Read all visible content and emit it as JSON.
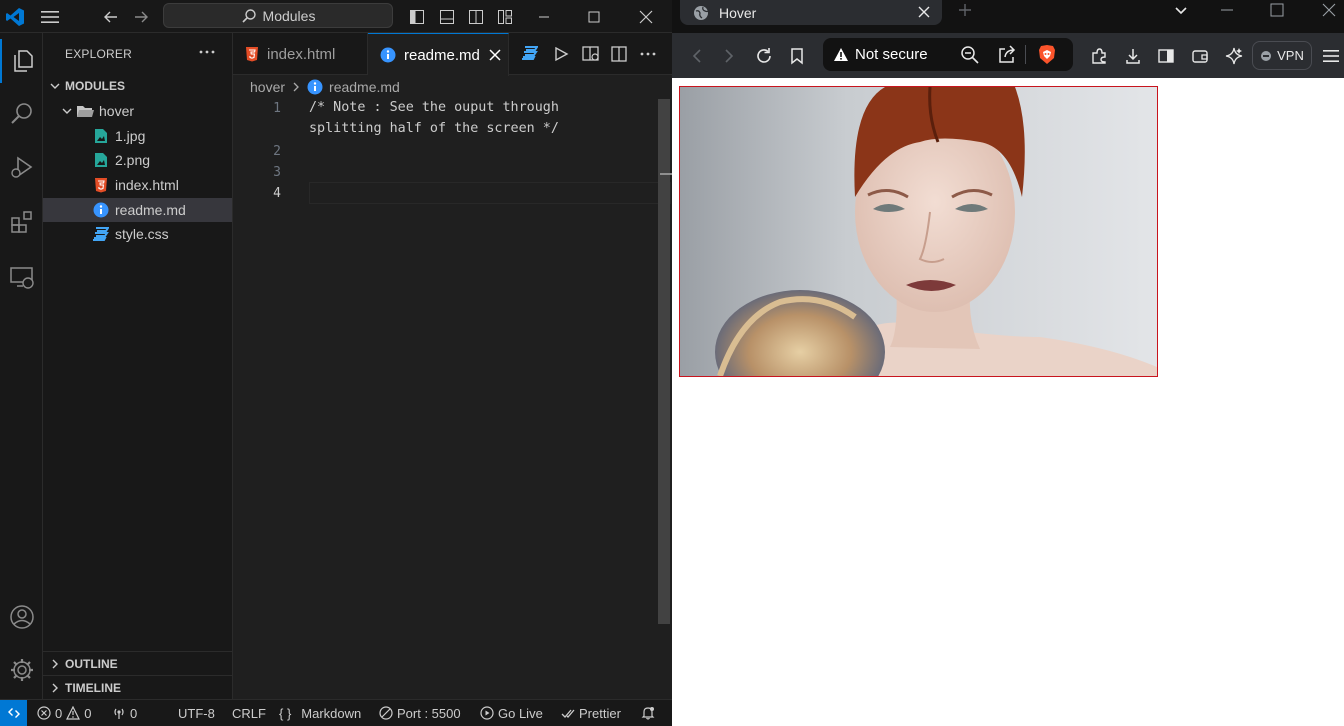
{
  "vscode": {
    "title_search": "Modules",
    "explorer_title": "EXPLORER",
    "folder_root": "MODULES",
    "folder_hover": "hover",
    "files": [
      {
        "name": "1.jpg",
        "icon": "image-file-icon"
      },
      {
        "name": "2.png",
        "icon": "image-file-icon"
      },
      {
        "name": "index.html",
        "icon": "html-file-icon"
      },
      {
        "name": "readme.md",
        "icon": "info-file-icon"
      },
      {
        "name": "style.css",
        "icon": "css-file-icon"
      }
    ],
    "tabs": [
      {
        "label": "index.html"
      },
      {
        "label": "readme.md"
      }
    ],
    "breadcrumb": {
      "folder": "hover",
      "file": "readme.md"
    },
    "editor": {
      "line_numbers": [
        "1",
        "2",
        "3",
        "4"
      ],
      "lines": [
        "/* Note : See the ouput through",
        "splitting half of the screen */",
        "",
        ""
      ]
    },
    "outline_label": "OUTLINE",
    "timeline_label": "TIMELINE",
    "status": {
      "errors": "0",
      "warnings": "0",
      "ports": "0",
      "encoding": "UTF-8",
      "eol": "CRLF",
      "language": "Markdown",
      "port": "Port : 5500",
      "golive": "Go Live",
      "prettier": "Prettier"
    }
  },
  "browser": {
    "tab_title": "Hover",
    "security_label": "Not secure",
    "vpn_label": "VPN"
  },
  "colors": {
    "accent": "#0078d4",
    "html_icon": "#e44d26",
    "css_icon": "#42a5f5",
    "info_icon": "#3794ff",
    "image_icon": "#26a69a",
    "brave": "#fb542b",
    "photo_border": "#c8141e"
  }
}
